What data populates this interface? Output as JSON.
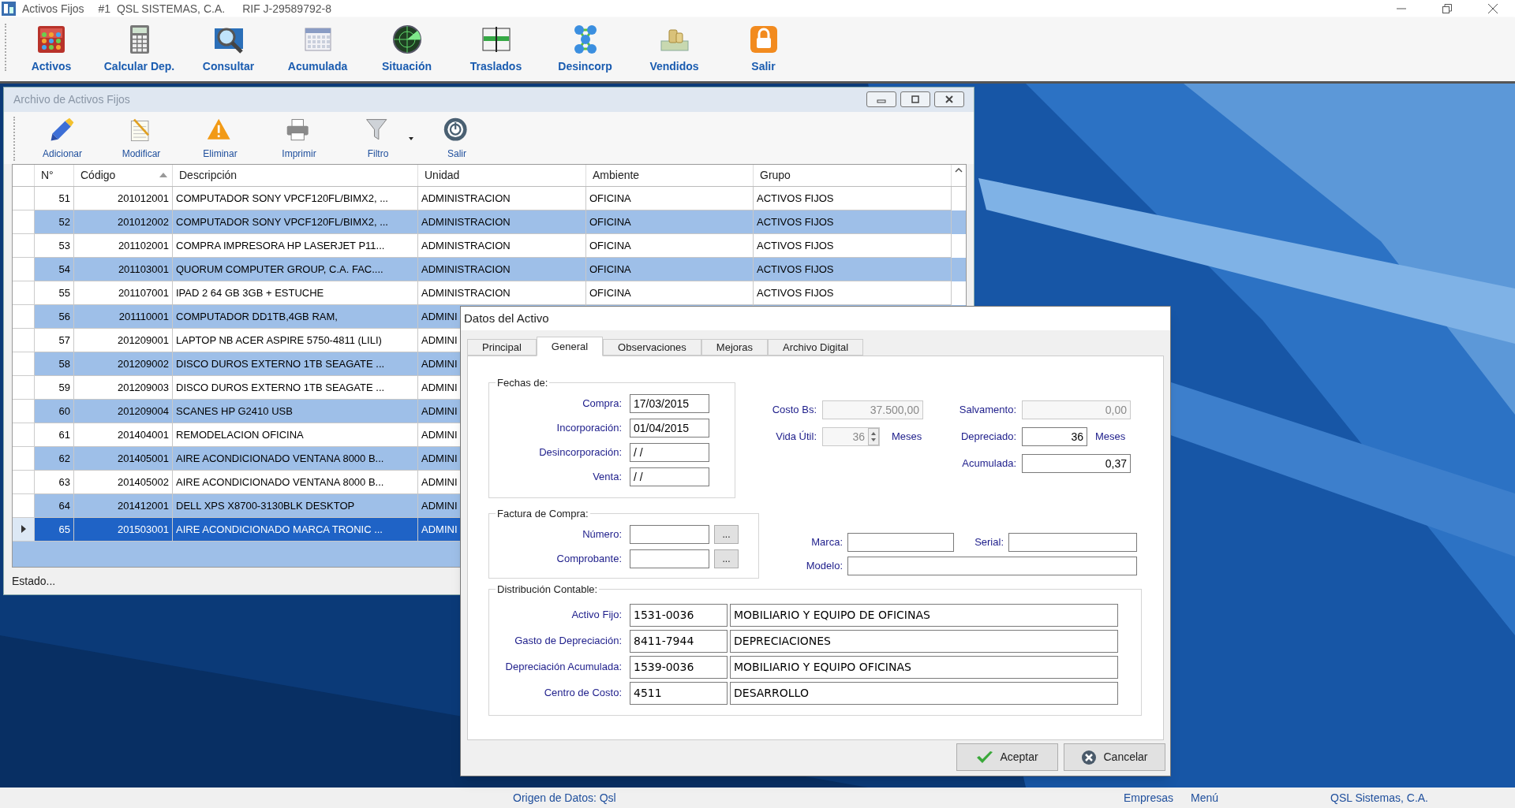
{
  "title_bar": {
    "app": "Activos Fijos",
    "company": "#1  QSL SISTEMAS, C.A.",
    "rif": "RIF J-29589792-8"
  },
  "toolbar": [
    {
      "label": "Activos"
    },
    {
      "label": "Calcular Dep."
    },
    {
      "label": "Consultar"
    },
    {
      "label": "Acumulada"
    },
    {
      "label": "Situación"
    },
    {
      "label": "Traslados"
    },
    {
      "label": "Desincorp"
    },
    {
      "label": "Vendidos"
    },
    {
      "label": "Salir"
    }
  ],
  "window": {
    "title": "Archivo de Activos Fijos",
    "toolbar": [
      {
        "label": "Adicionar",
        "dropdown": false
      },
      {
        "label": "Modificar",
        "dropdown": false
      },
      {
        "label": "Eliminar",
        "dropdown": false
      },
      {
        "label": "Imprimir",
        "dropdown": false
      },
      {
        "label": "Filtro",
        "dropdown": true
      },
      {
        "label": "Salir",
        "dropdown": false
      }
    ],
    "table": {
      "columns": [
        {
          "label": "N°",
          "sorted": false
        },
        {
          "label": "Código",
          "sorted": true
        },
        {
          "label": "Descripción",
          "sorted": false
        },
        {
          "label": "Unidad",
          "sorted": false
        },
        {
          "label": "Ambiente",
          "sorted": false
        },
        {
          "label": "Grupo",
          "sorted": false
        }
      ],
      "rows": [
        {
          "selected": false,
          "cells": [
            "51",
            "201012001",
            "COMPUTADOR SONY VPCF120FL/BIMX2, ...",
            "ADMINISTRACION",
            "OFICINA",
            "ACTIVOS FIJOS"
          ]
        },
        {
          "selected": false,
          "cells": [
            "52",
            "201012002",
            "COMPUTADOR SONY VPCF120FL/BIMX2, ...",
            "ADMINISTRACION",
            "OFICINA",
            "ACTIVOS FIJOS"
          ]
        },
        {
          "selected": false,
          "cells": [
            "53",
            "201102001",
            "COMPRA IMPRESORA HP LASERJET P11...",
            "ADMINISTRACION",
            "OFICINA",
            "ACTIVOS FIJOS"
          ]
        },
        {
          "selected": false,
          "cells": [
            "54",
            "201103001",
            "QUORUM COMPUTER GROUP, C.A. FAC....",
            "ADMINISTRACION",
            "OFICINA",
            "ACTIVOS FIJOS"
          ]
        },
        {
          "selected": false,
          "cells": [
            "55",
            "201107001",
            "IPAD 2 64 GB 3GB + ESTUCHE",
            "ADMINISTRACION",
            "OFICINA",
            "ACTIVOS FIJOS"
          ]
        },
        {
          "selected": false,
          "cells": [
            "56",
            "201110001",
            "COMPUTADOR DD1TB,4GB RAM,",
            "ADMINI"
          ]
        },
        {
          "selected": false,
          "cells": [
            "57",
            "201209001",
            "LAPTOP NB ACER ASPIRE 5750-4811 (LILI)",
            "ADMINI"
          ]
        },
        {
          "selected": false,
          "cells": [
            "58",
            "201209002",
            "DISCO DUROS EXTERNO 1TB SEAGATE ...",
            "ADMINI"
          ]
        },
        {
          "selected": false,
          "cells": [
            "59",
            "201209003",
            "DISCO DUROS EXTERNO 1TB SEAGATE ...",
            "ADMINI"
          ]
        },
        {
          "selected": false,
          "cells": [
            "60",
            "201209004",
            "SCANES HP G2410 USB",
            "ADMINI"
          ]
        },
        {
          "selected": false,
          "cells": [
            "61",
            "201404001",
            "REMODELACION OFICINA",
            "ADMINI"
          ]
        },
        {
          "selected": false,
          "cells": [
            "62",
            "201405001",
            "AIRE ACONDICIONADO VENTANA 8000 B...",
            "ADMINI"
          ]
        },
        {
          "selected": false,
          "cells": [
            "63",
            "201405002",
            "AIRE ACONDICIONADO VENTANA 8000 B...",
            "ADMINI"
          ]
        },
        {
          "selected": false,
          "cells": [
            "64",
            "201412001",
            "DELL XPS X8700-3130BLK DESKTOP",
            "ADMINI"
          ]
        },
        {
          "selected": true,
          "cells": [
            "65",
            "201503001",
            "AIRE ACONDICIONADO MARCA TRONIC ...",
            "ADMINI"
          ]
        }
      ]
    },
    "status": "Estado..."
  },
  "dialog": {
    "title": "Datos del Activo",
    "tabs": [
      {
        "label": "Principal",
        "selected": false
      },
      {
        "label": "General",
        "selected": true
      },
      {
        "label": "Observaciones",
        "selected": false
      },
      {
        "label": "Mejoras",
        "selected": false
      },
      {
        "label": "Archivo Digital",
        "selected": false
      }
    ],
    "fechas": {
      "legend": "Fechas de:",
      "fields": [
        {
          "label": "Compra:",
          "value": "17/03/2015"
        },
        {
          "label": "Incorporación:",
          "value": "01/04/2015"
        },
        {
          "label": "Desincorporación:",
          "value": "/ /"
        },
        {
          "label": "Venta:",
          "value": "/ /"
        }
      ]
    },
    "costo": {
      "label": "Costo Bs:",
      "value": "37.500,00",
      "disabled": true
    },
    "salvamento": {
      "label": "Salvamento:",
      "value": "0,00",
      "disabled": true
    },
    "vida_util": {
      "label": "Vida Útil:",
      "value": "36",
      "disabled": true,
      "unit": "Meses"
    },
    "depreciado": {
      "label": "Depreciado:",
      "value": "36",
      "disabled": false,
      "unit": "Meses"
    },
    "acumulada": {
      "label": "Acumulada:",
      "value": "0,37",
      "disabled": false
    },
    "factura": {
      "legend": "Factura de Compra:",
      "fields": [
        {
          "label": "Número:",
          "button": "..."
        },
        {
          "label": "Comprobante:",
          "button": "..."
        }
      ]
    },
    "marca": {
      "label": "Marca:"
    },
    "serial": {
      "label": "Serial:"
    },
    "modelo": {
      "label": "Modelo:"
    },
    "distribucion": {
      "legend": "Distribución Contable:",
      "rows": [
        {
          "label": "Activo Fijo:",
          "code": "1531-0036",
          "name": "MOBILIARIO Y EQUIPO DE OFICINAS"
        },
        {
          "label": "Gasto de Depreciación:",
          "code": "8411-7944",
          "name": "DEPRECIACIONES"
        },
        {
          "label": "Depreciación Acumulada:",
          "code": "1539-0036",
          "name": "MOBILIARIO Y EQUIPO OFICINAS"
        },
        {
          "label": "Centro de Costo:",
          "code": "4511",
          "name": "DESARROLLO"
        }
      ]
    },
    "buttons": [
      {
        "label": "Aceptar"
      },
      {
        "label": "Cancelar"
      }
    ]
  },
  "status_bar": {
    "source": "Origen de Datos: Qsl",
    "links": [
      "Empresas",
      "Menú"
    ],
    "company": "QSL Sistemas, C.A."
  }
}
